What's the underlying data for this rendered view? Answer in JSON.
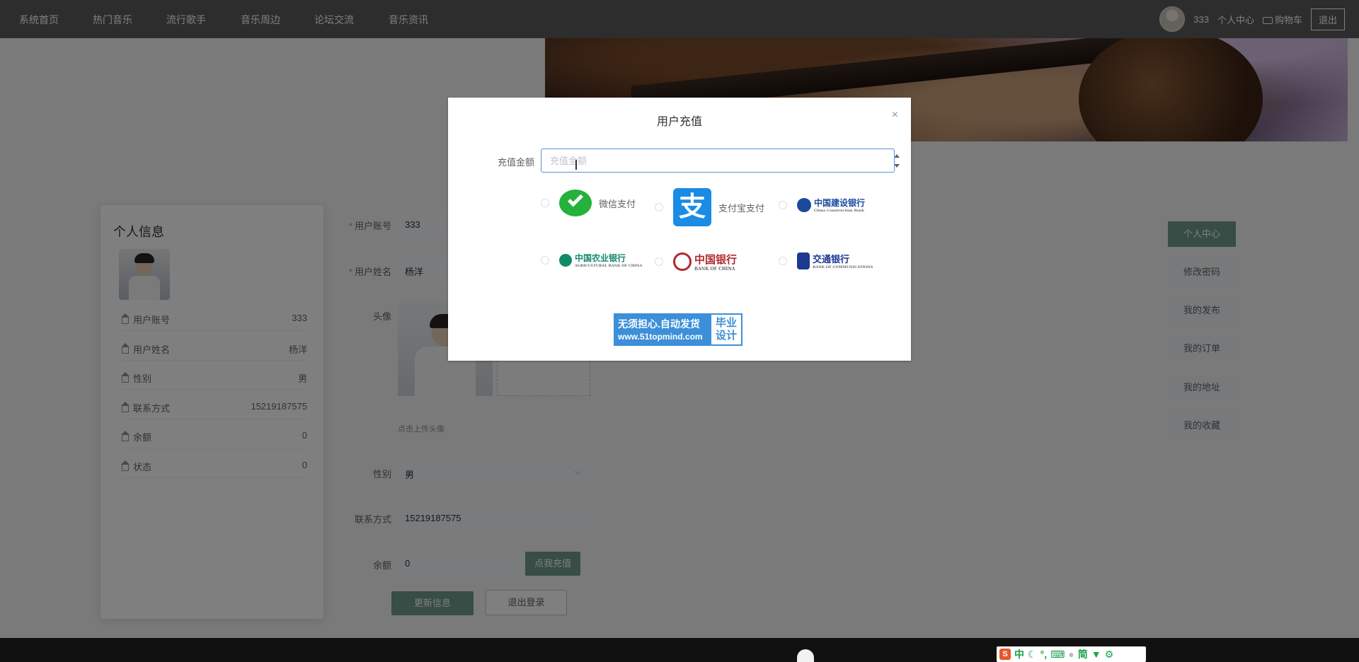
{
  "nav": {
    "items": [
      "系统首页",
      "热门音乐",
      "流行歌手",
      "音乐周边",
      "论坛交流",
      "音乐资讯"
    ],
    "username": "333",
    "profile_label": "个人中心",
    "cart_label": "购物车",
    "logout_label": "退出"
  },
  "profile_card": {
    "title": "个人信息",
    "rows": [
      {
        "label": "用户账号",
        "value": "333"
      },
      {
        "label": "用户姓名",
        "value": "杨洋"
      },
      {
        "label": "性别",
        "value": "男"
      },
      {
        "label": "联系方式",
        "value": "15219187575"
      },
      {
        "label": "余额",
        "value": "0"
      },
      {
        "label": "状态",
        "value": "0"
      }
    ]
  },
  "form": {
    "account_label": "用户账号",
    "account_value": "333",
    "name_label": "用户姓名",
    "name_value": "杨洋",
    "avatar_label": "头像",
    "upload_hint": "点击上传头像",
    "gender_label": "性别",
    "gender_value": "男",
    "phone_label": "联系方式",
    "phone_value": "15219187575",
    "balance_label": "余额",
    "balance_value": "0",
    "recharge_button": "点我充值",
    "update_button": "更新信息",
    "logout_button": "退出登录"
  },
  "right_menu": [
    {
      "label": "个人中心",
      "active": true
    },
    {
      "label": "修改密码",
      "active": false
    },
    {
      "label": "我的发布",
      "active": false
    },
    {
      "label": "我的订单",
      "active": false
    },
    {
      "label": "我的地址",
      "active": false
    },
    {
      "label": "我的收藏",
      "active": false
    }
  ],
  "dialog": {
    "title": "用户充值",
    "close": "×",
    "amount_label": "充值金额",
    "amount_placeholder": "充值金额",
    "amount_value": "",
    "payment_options": [
      {
        "name": "微信支付",
        "icon": "wechat-pay-icon"
      },
      {
        "name": "支付宝支付",
        "icon": "alipay-icon"
      },
      {
        "name": "中国建设银行",
        "sub": "China Construction Bank",
        "icon": "ccb-logo"
      },
      {
        "name": "中国农业银行",
        "sub": "AGRICULTURAL BANK OF CHINA",
        "icon": "abc-logo"
      },
      {
        "name": "中国银行",
        "sub": "BANK OF CHINA",
        "icon": "boc-logo"
      },
      {
        "name": "交通银行",
        "sub": "BANK OF COMMUNICATIONS",
        "icon": "bocom-logo"
      }
    ]
  },
  "watermark": {
    "line1": "无须担心.自动发货",
    "line2": "www.51topmind.com",
    "right1": "毕业",
    "right2": "设计"
  },
  "ime": {
    "items": [
      "中",
      "简"
    ]
  },
  "colors": {
    "accent": "#6f9a8a",
    "nav_bg": "#5a5a5a",
    "input_focus": "#5b8fd6",
    "wechat_green": "#25b13a",
    "alipay_blue": "#1a8ce6"
  }
}
